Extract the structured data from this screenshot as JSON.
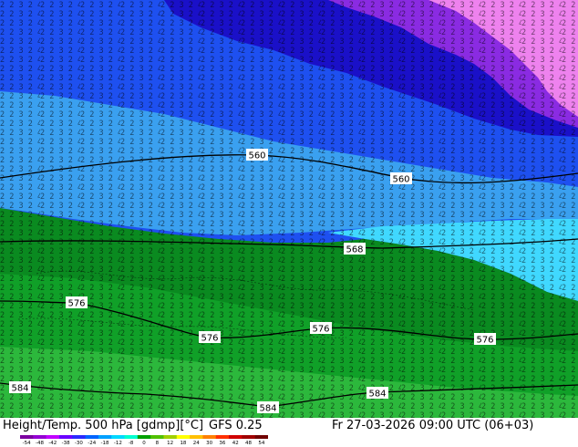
{
  "title": "Height/Temp. 500 hPa [gdmp][°C]",
  "model": "GFS 0.25",
  "valid_time": "Fr 27-03-2026 09:00 UTC (06+03)",
  "contour_labels": [
    {
      "text": "560",
      "id": "560-a"
    },
    {
      "text": "560",
      "id": "560-b"
    },
    {
      "text": "568",
      "id": "568"
    },
    {
      "text": "576",
      "id": "576-a"
    },
    {
      "text": "576",
      "id": "576-b"
    },
    {
      "text": "576",
      "id": "576-c"
    },
    {
      "text": "576",
      "id": "576-d"
    },
    {
      "text": "584",
      "id": "584-a"
    },
    {
      "text": "584",
      "id": "584-b"
    },
    {
      "text": "584",
      "id": "584-c"
    }
  ],
  "colorbar": {
    "ticks": [
      "-54",
      "-48",
      "-42",
      "-38",
      "-30",
      "-24",
      "-18",
      "-12",
      "-8",
      "0",
      "8",
      "12",
      "18",
      "24",
      "30",
      "36",
      "42",
      "48",
      "54"
    ],
    "colors": [
      "#7c00a0",
      "#9400d3",
      "#c000ff",
      "#6a00ff",
      "#2a2aff",
      "#0064ff",
      "#00a0ff",
      "#00d8ff",
      "#00ffd0",
      "#00a000",
      "#50c000",
      "#a0d000",
      "#ffff00",
      "#ffc000",
      "#ff8000",
      "#ff3000",
      "#d00000",
      "#a00000",
      "#700000"
    ]
  },
  "palette": {
    "magenta": "#ee82ee",
    "violet": "#8a2be2",
    "dark_blue": "#1a10c8",
    "blue": "#1e50f0",
    "sky_blue": "#3aa0f0",
    "cyan": "#40d8ff",
    "dark_green": "#0a8a20",
    "green": "#10a028",
    "light_green": "#2cb83c"
  }
}
